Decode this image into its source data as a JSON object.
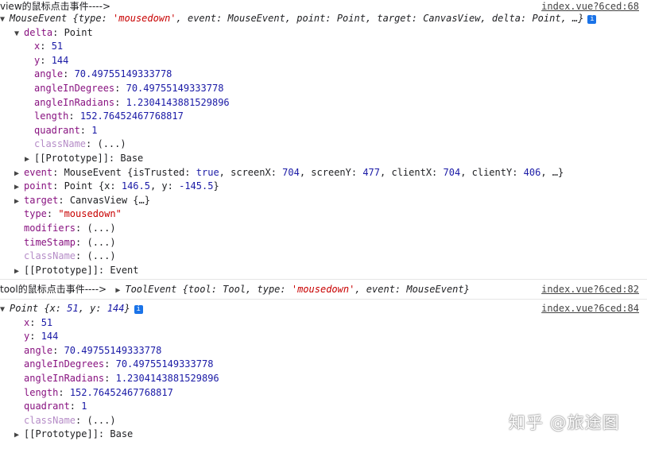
{
  "group1": {
    "msg": "view的鼠标点击事件---->",
    "source": "index.vue?6ced:68",
    "summary_prefix": "MouseEvent {type: ",
    "summary_type": "'mousedown'",
    "summary_rest": ", event: MouseEvent, point: Point, target: CanvasView, delta: Point, …}",
    "delta_label": "delta",
    "delta_type": "Point",
    "delta_props": [
      {
        "key": "x",
        "value": "51"
      },
      {
        "key": "y",
        "value": "144"
      },
      {
        "key": "angle",
        "value": "70.49755149333778"
      },
      {
        "key": "angleInDegrees",
        "value": "70.49755149333778"
      },
      {
        "key": "angleInRadians",
        "value": "1.2304143881529896"
      },
      {
        "key": "length",
        "value": "152.76452467768817"
      },
      {
        "key": "quadrant",
        "value": "1"
      },
      {
        "key": "className",
        "value": "(...)"
      }
    ],
    "delta_proto_label": "[[Prototype]]",
    "delta_proto_value": "Base",
    "event_label": "event",
    "event_type": "MouseEvent",
    "event_open": "{isTrusted: ",
    "event_trusted": "true",
    "event_mid1": ", screenX: ",
    "event_screenX": "704",
    "event_mid2": ", screenY: ",
    "event_screenY": "477",
    "event_mid3": ", clientX: ",
    "event_clientX": "704",
    "event_mid4": ", clientY: ",
    "event_clientY": "406",
    "event_tail": ", …}",
    "point_label": "point",
    "point_type": "Point",
    "point_open": "{x: ",
    "point_x": "146.5",
    "point_mid": ", y: ",
    "point_y": "-145.5",
    "point_close": "}",
    "target_label": "target",
    "target_value": "CanvasView {…}",
    "type_label": "type",
    "type_value": "\"mousedown\"",
    "modifiers_label": "modifiers",
    "modifiers_value": "(...)",
    "timeStamp_label": "timeStamp",
    "timeStamp_value": "(...)",
    "className_label": "className",
    "className_value": "(...)",
    "proto_label": "[[Prototype]]",
    "proto_value": "Event"
  },
  "group2": {
    "msg": "tool的鼠标点击事件---->",
    "source": "index.vue?6ced:82",
    "summary_prefix": "ToolEvent {tool: Tool, type: ",
    "summary_type": "'mousedown'",
    "summary_rest": ", event: MouseEvent}"
  },
  "group3": {
    "source": "index.vue?6ced:84",
    "summary_prefix": "Point {x: ",
    "summary_x": "51",
    "summary_mid": ", y: ",
    "summary_y": "144",
    "summary_close": "}",
    "props": [
      {
        "key": "x",
        "value": "51"
      },
      {
        "key": "y",
        "value": "144"
      },
      {
        "key": "angle",
        "value": "70.49755149333778"
      },
      {
        "key": "angleInDegrees",
        "value": "70.49755149333778"
      },
      {
        "key": "angleInRadians",
        "value": "1.2304143881529896"
      },
      {
        "key": "length",
        "value": "152.76452467768817"
      },
      {
        "key": "quadrant",
        "value": "1"
      },
      {
        "key": "className",
        "value": "(...)"
      }
    ],
    "proto_label": "[[Prototype]]",
    "proto_value": "Base"
  },
  "info_glyph": "i",
  "watermark": "知乎 @旅途图"
}
